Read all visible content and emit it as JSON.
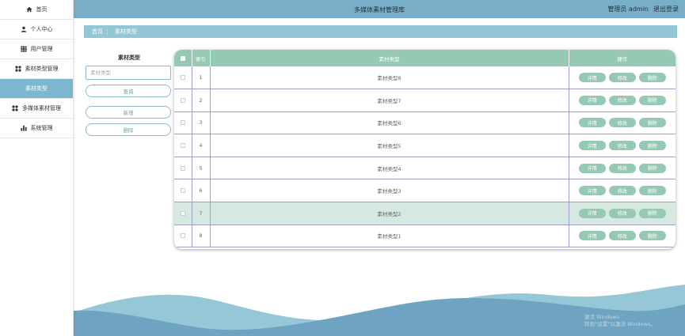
{
  "app": {
    "title": "多媒体素材管理库",
    "admin_label": "管理员 admin",
    "logout_label": "退出登录"
  },
  "sidebar": {
    "items": [
      {
        "label": "首页",
        "icon": "home-icon"
      },
      {
        "label": "个人中心",
        "icon": "user-icon"
      },
      {
        "label": "用户管理",
        "icon": "grid-icon"
      },
      {
        "label": "素材类型管理",
        "icon": "apps-icon"
      },
      {
        "label": "素材类型",
        "icon": ""
      },
      {
        "label": "多媒体素材管理",
        "icon": "apps-icon"
      },
      {
        "label": "系统管理",
        "icon": "bar-chart-icon"
      }
    ],
    "active_index": 4
  },
  "breadcrumb": {
    "home": "首页",
    "separator": "：",
    "current": "素材类型"
  },
  "search": {
    "label": "素材类型",
    "placeholder": "素材类型",
    "query_button": "查询",
    "add_button": "新增",
    "delete_button": "删除"
  },
  "table": {
    "headers": {
      "index": "索引",
      "type": "素材类型",
      "ops": "操作"
    },
    "rows": [
      {
        "index": "1",
        "type": "素材类型8"
      },
      {
        "index": "2",
        "type": "素材类型7"
      },
      {
        "index": "3",
        "type": "素材类型6"
      },
      {
        "index": "4",
        "type": "素材类型5"
      },
      {
        "index": "5",
        "type": "素材类型4"
      },
      {
        "index": "6",
        "type": "素材类型3"
      },
      {
        "index": "7",
        "type": "素材类型2"
      },
      {
        "index": "8",
        "type": "素材类型1"
      }
    ],
    "highlighted_row": 6,
    "row_actions": {
      "detail": "详情",
      "edit": "修改",
      "delete": "删除"
    }
  },
  "colors": {
    "topbar": "#79aec8",
    "accent_green": "#96c9b3",
    "sidebar_active": "#7cb7cf",
    "breadcrumb": "#93c7d6",
    "wave_light": "#95c7d6",
    "wave_dark": "#6fa3c2"
  },
  "watermark": {
    "line1": "激活 Windows",
    "line2": "转到“设置”以激活 Windows。"
  }
}
